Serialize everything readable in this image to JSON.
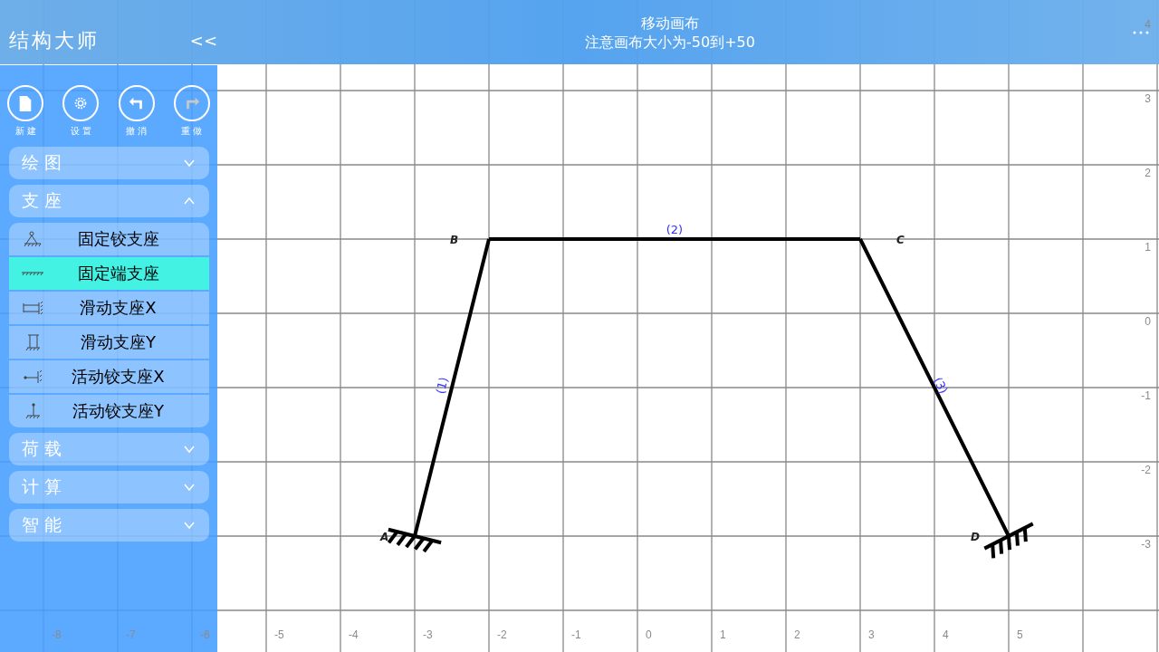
{
  "header": {
    "title": "结构大师",
    "collapse": "<<",
    "mode": "移动画布",
    "hint": "注意画布大小为-50到+50"
  },
  "toolbar": [
    {
      "label": "新建",
      "disabled": false
    },
    {
      "label": "设置",
      "disabled": false
    },
    {
      "label": "撤消",
      "disabled": false
    },
    {
      "label": "重做",
      "disabled": true
    }
  ],
  "sections": [
    {
      "label": "绘 图",
      "expanded": false
    },
    {
      "label": "支 座",
      "expanded": true,
      "items": [
        {
          "label": "固定铰支座",
          "selected": false
        },
        {
          "label": "固定端支座",
          "selected": true
        },
        {
          "label": "滑动支座X",
          "selected": false
        },
        {
          "label": "滑动支座Y",
          "selected": false
        },
        {
          "label": "活动铰支座X",
          "selected": false
        },
        {
          "label": "活动铰支座Y",
          "selected": false
        }
      ]
    },
    {
      "label": "荷 载",
      "expanded": false
    },
    {
      "label": "计 算",
      "expanded": false
    },
    {
      "label": "智 能",
      "expanded": false
    }
  ],
  "canvas": {
    "x_ticks": [
      "-8",
      "-7",
      "-6",
      "-5",
      "-4",
      "-3",
      "-2",
      "-1",
      "0",
      "1",
      "2",
      "3",
      "4",
      "5"
    ],
    "y_ticks": [
      "4",
      "3",
      "2",
      "1",
      "0",
      "-1",
      "-2",
      "-3"
    ],
    "nodes": [
      {
        "label": "A",
        "kind": "fixed"
      },
      {
        "label": "B",
        "kind": "free"
      },
      {
        "label": "C",
        "kind": "free"
      },
      {
        "label": "D",
        "kind": "fixed"
      }
    ],
    "members": [
      {
        "label": "(1)"
      },
      {
        "label": "(2)"
      },
      {
        "label": "(3)"
      }
    ]
  }
}
